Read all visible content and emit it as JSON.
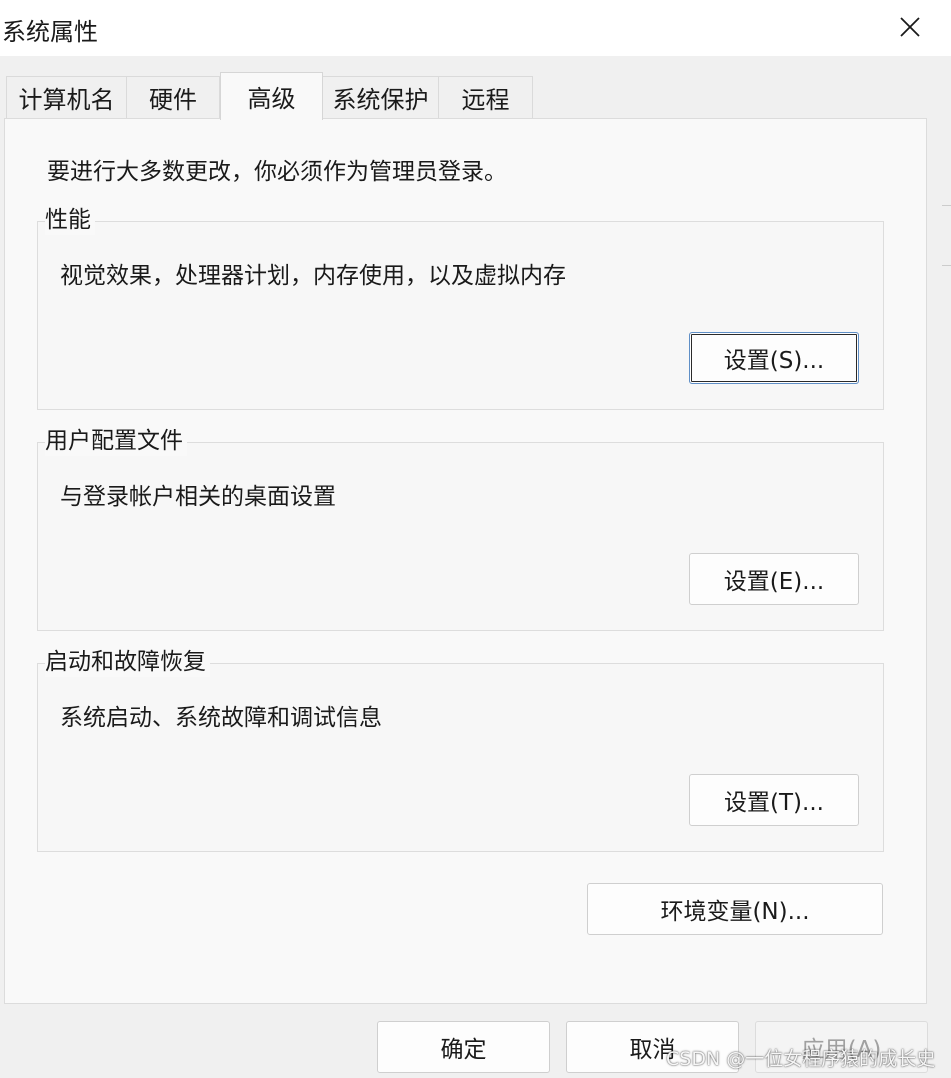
{
  "window": {
    "title": "系统属性"
  },
  "tabs": [
    {
      "label": "计算机名"
    },
    {
      "label": "硬件"
    },
    {
      "label": "高级"
    },
    {
      "label": "系统保护"
    },
    {
      "label": "远程"
    }
  ],
  "active_tab": "高级",
  "admin_note": "要进行大多数更改，你必须作为管理员登录。",
  "groups": {
    "performance": {
      "title": "性能",
      "description": "视觉效果，处理器计划，内存使用，以及虚拟内存",
      "button": "设置(S)..."
    },
    "profiles": {
      "title": "用户配置文件",
      "description": "与登录帐户相关的桌面设置",
      "button": "设置(E)..."
    },
    "startup": {
      "title": "启动和故障恢复",
      "description": "系统启动、系统故障和调试信息",
      "button": "设置(T)..."
    }
  },
  "env_button": "环境变量(N)...",
  "footer": {
    "ok": "确定",
    "cancel": "取消",
    "apply": "应用(A)"
  },
  "watermark": "CSDN @一位女程序猿的成长史",
  "icons": {
    "close": "close-icon"
  },
  "colors": {
    "focus_border": "#5f8fc7",
    "disabled_text": "#a0a0a0"
  }
}
